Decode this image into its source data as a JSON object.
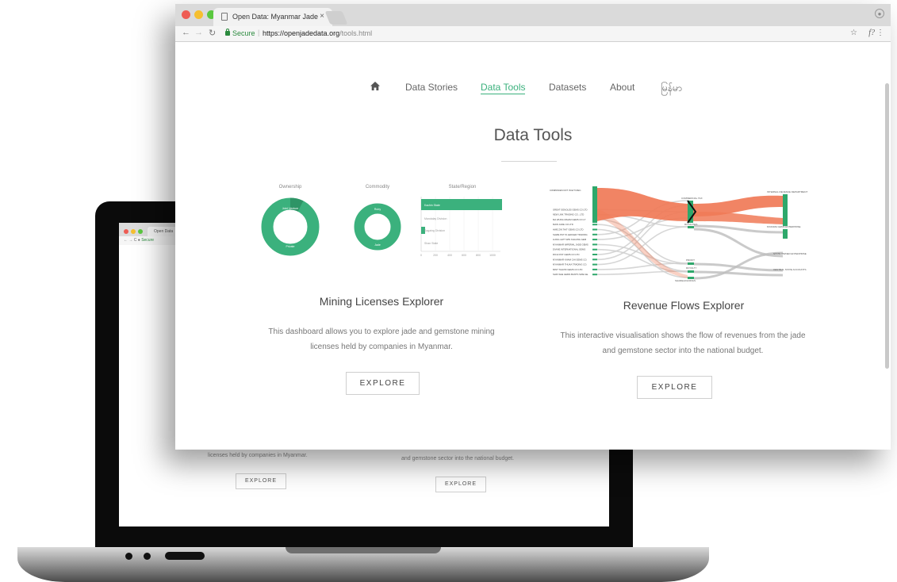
{
  "browser": {
    "tab_title": "Open Data: Myanmar Jade",
    "tab_close": "×",
    "secure_label": "Secure",
    "url_host": "https://openjadedata.org",
    "url_path": "/tools.html",
    "star_icon": "☆",
    "extension_label": "f?",
    "menu_icon": "⋮"
  },
  "nav": {
    "home_icon": "home-icon",
    "items": [
      "Data Stories",
      "Data Tools",
      "Datasets",
      "About",
      "မြန်မာ"
    ],
    "active": "Data Tools"
  },
  "page": {
    "title": "Data Tools"
  },
  "cards": [
    {
      "title": "Mining Licenses Explorer",
      "desc_line1": "This dashboard allows you to explore jade and gemstone mining",
      "desc_line2": "licenses held by companies in Myanmar.",
      "button": "EXPLORE"
    },
    {
      "title": "Revenue Flows Explorer",
      "desc_line1": "This interactive visualisation shows the flow of revenues from the jade",
      "desc_line2": "and gemstone sector into the national budget.",
      "button": "EXPLORE"
    }
  ],
  "thumb_dashboard": {
    "ownership_label": "Ownership",
    "ownership_top": "Joint Venture",
    "ownership_bottom": "Private",
    "commodity_label": "Commodity",
    "commodity_top": "Ruby",
    "commodity_bottom": "Jade",
    "region_label": "State/Region",
    "region_bars": [
      "Kachin State",
      "Mandalay Division",
      "Sagaing Division",
      "Shan State"
    ],
    "region_axis": [
      "0",
      "200",
      "400",
      "600",
      "800",
      "1000"
    ]
  },
  "thumb_sankey": {
    "nodes_left": [
      "COMPANIES NOT IN EITI REC.",
      "GREAT GENOLES GEMS CO LTD",
      "NEW LINK TRADING CO., LTD",
      "MA WUNG MAIAM GEMS CO LT",
      "MAIN JADE CO LTD",
      "HWE ZIN THIT GEMS CO LTD",
      "SHWE PAT TA LEDGER TRADING",
      "LIANG LETT WIN KHAUNG GEM",
      "MYANMAR IMPERIAL JADE GEMS",
      "DIVINE INTERNATIONAL GEMS",
      "RICH FIST GEMS CO LTD",
      "MYANMAR KHAM CHI GEMS CO.",
      "MYANMAR THUKA TRADING CO.",
      "MINT TAHVIN GEMS CO LTD",
      "SHIN SHE GEMS BANTS SWE GE."
    ],
    "nodes_mid": [
      "COMMERCIAL TAX",
      "ROYALTIES",
      "PROFIT",
      "ROYALTY",
      "SHAREHOLDINGS"
    ],
    "nodes_right": [
      "INTERNAL REVENUE DEPARTMENT",
      "MYANMA GEMS ENTERPRISE",
      "STATE-OWNED ENTERPRISE",
      "CENTRAL STATE ACCOUNTS"
    ]
  },
  "laptop": {
    "mini_tab_title": "Open Data",
    "mini_secure": "Secure",
    "mini_text_1": "licenses held by companies in Myanmar.",
    "mini_text_2": "and gemstone sector into the national budget.",
    "mini_button_1": "EXPLORE",
    "mini_button_2": "EXPLORE"
  },
  "colors": {
    "accent_green": "#3bb17d",
    "sankey_orange": "#f07a57",
    "sankey_green": "#2ea86b"
  }
}
